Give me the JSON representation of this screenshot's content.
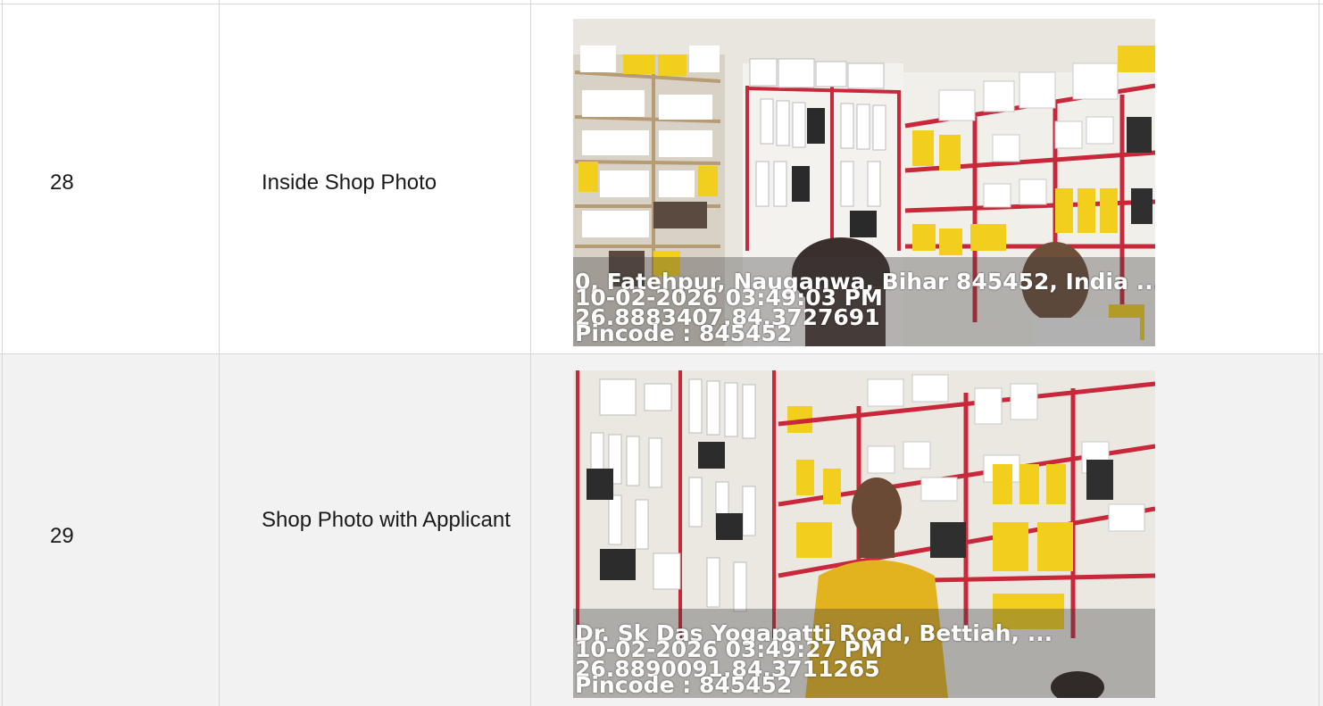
{
  "rows": [
    {
      "serial": "28",
      "label": "Inside Shop Photo",
      "photo": {
        "address": "0, Fatehpur, Nauganwa, Bihar 845452, India ...",
        "datetime": "10-02-2026 03:49:03 PM",
        "coords": "26.8883407,84.3727691",
        "pincode": "Pincode : 845452"
      }
    },
    {
      "serial": "29",
      "label": "Shop Photo with Applicant",
      "photo": {
        "address": "Dr. Sk Das Yogapatti Road, Bettiah, ...",
        "datetime": "10-02-2026 03:49:27 PM",
        "coords": "26.8890091,84.3711265",
        "pincode": "Pincode : 845452"
      }
    }
  ],
  "colors": {
    "border": "#d7d7d7",
    "row_alt_bg": "#f2f2f2",
    "shelf_red": "#c8283a",
    "wall": "#ece9e3",
    "product_yellow": "#f2cf1c"
  }
}
